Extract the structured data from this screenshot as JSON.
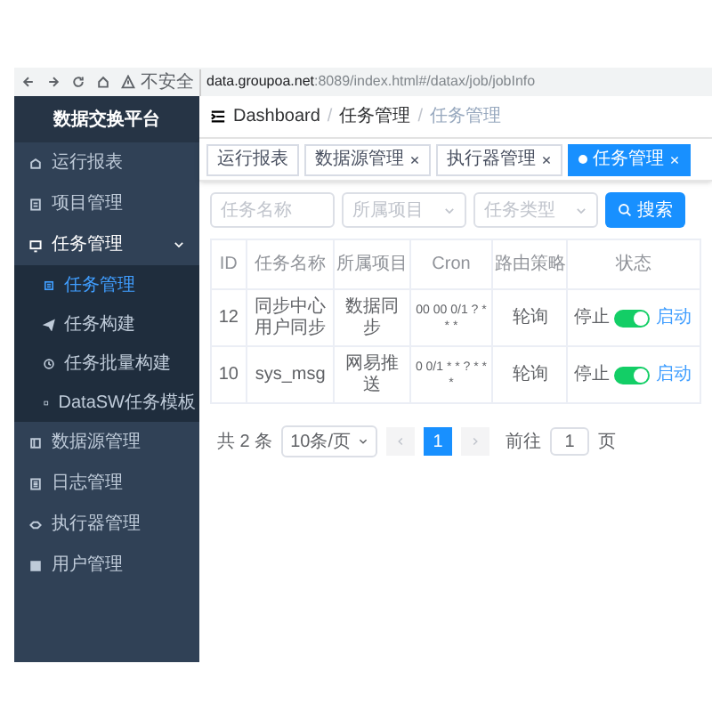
{
  "browser": {
    "security_label": "不安全",
    "url_host": "data.groupoa.net",
    "url_path": ":8089/index.html#/datax/job/jobInfo"
  },
  "sidebar": {
    "title": "数据交换平台",
    "items": [
      {
        "label": "运行报表",
        "selected": false
      },
      {
        "label": "项目管理",
        "selected": false
      },
      {
        "label": "任务管理",
        "selected": false,
        "expanded": true,
        "children": [
          {
            "label": "任务管理",
            "selected": true
          },
          {
            "label": "任务构建",
            "selected": false
          },
          {
            "label": "任务批量构建",
            "selected": false
          },
          {
            "label": "DataSW任务模板",
            "selected": false
          }
        ]
      },
      {
        "label": "数据源管理",
        "selected": false
      },
      {
        "label": "日志管理",
        "selected": false
      },
      {
        "label": "执行器管理",
        "selected": false
      },
      {
        "label": "用户管理",
        "selected": false
      }
    ]
  },
  "breadcrumb": [
    "Dashboard",
    "任务管理",
    "任务管理"
  ],
  "breadcrumb_separator": "/",
  "tags": [
    {
      "label": "运行报表",
      "closable": false,
      "selected": false
    },
    {
      "label": "数据源管理",
      "closable": true,
      "selected": false
    },
    {
      "label": "执行器管理",
      "closable": true,
      "selected": false
    },
    {
      "label": "任务管理",
      "closable": true,
      "selected": true
    }
  ],
  "filters": [
    {
      "kind": "input",
      "placeholder": "任务名称"
    },
    {
      "kind": "select",
      "placeholder": "所属项目"
    },
    {
      "kind": "select",
      "placeholder": "任务类型"
    }
  ],
  "search_button": "搜索",
  "table": {
    "columns": [
      "ID",
      "任务名称",
      "所属项目",
      "Cron",
      "路由策略",
      "状态"
    ],
    "rows": [
      {
        "id": "12",
        "name": "同步中心用户同步",
        "project": "数据同步",
        "cron": "00 00 0/1 ? * * *",
        "route": "轮询",
        "status": {
          "off_label": "停止",
          "on_label": "启动",
          "on": true
        }
      },
      {
        "id": "10",
        "name": "sys_msg",
        "project": "网易推送",
        "cron": "0 0/1 * * ? * * *",
        "route": "轮询",
        "status": {
          "off_label": "停止",
          "on_label": "启动",
          "on": true
        }
      }
    ]
  },
  "pagination": {
    "total": "共 2 条",
    "page_size": "10条/页",
    "pages": [
      {
        "label": "1",
        "selected": true
      }
    ],
    "goto_label": "前往",
    "goto_value": "1",
    "goto_suffix": "页"
  }
}
